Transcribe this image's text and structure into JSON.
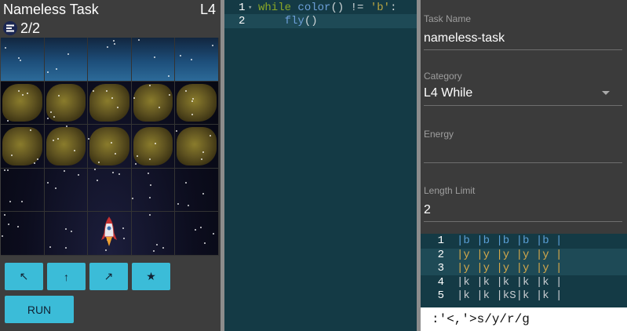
{
  "task": {
    "title": "Nameless Task",
    "level": "L4",
    "energy": "2/2",
    "energy_icon": "energy-icon"
  },
  "board": {
    "rows": [
      [
        "sky",
        "sky",
        "sky",
        "sky",
        "sky"
      ],
      [
        "asteroid",
        "asteroid",
        "asteroid",
        "asteroid",
        "asteroid"
      ],
      [
        "asteroid",
        "asteroid",
        "asteroid",
        "asteroid",
        "asteroid"
      ],
      [
        "space",
        "space",
        "space",
        "space",
        "space"
      ],
      [
        "space",
        "space",
        "rocket",
        "space",
        "space"
      ]
    ]
  },
  "controls": {
    "left": "↖",
    "forward": "↑",
    "right": "↗",
    "shoot": "★",
    "run": "RUN"
  },
  "editor": {
    "lines": [
      {
        "num": "1",
        "tokens": [
          [
            "kw",
            "while "
          ],
          [
            "fn",
            "color"
          ],
          [
            "op",
            "() != "
          ],
          [
            "str",
            "'b'"
          ],
          [
            "op",
            ":"
          ]
        ]
      },
      {
        "num": "2",
        "tokens": [
          [
            "op",
            "    "
          ],
          [
            "fn",
            "fly"
          ],
          [
            "op",
            "()"
          ]
        ]
      }
    ]
  },
  "form": {
    "task_name_label": "Task Name",
    "task_name_value": "nameless-task",
    "category_label": "Category",
    "category_value": "L4 While",
    "energy_label": "Energy",
    "energy_value": "",
    "length_label": "Length Limit",
    "length_value": "2"
  },
  "grid_source": {
    "lines": [
      {
        "num": "1",
        "text": "|b |b |b |b |b |",
        "color": "b"
      },
      {
        "num": "2",
        "text": "|y |y |y |y |y |",
        "color": "y"
      },
      {
        "num": "3",
        "text": "|y |y |y |y |y |",
        "color": "y"
      },
      {
        "num": "4",
        "text": "|k |k |k |k |k |",
        "color": "k"
      },
      {
        "num": "5",
        "text": "|k |k |kS|k |k |",
        "color": "k"
      }
    ]
  },
  "command": ":'<,'>s/y/r/g",
  "colors": {
    "accent": "#3bbcd8",
    "editor_bg": "#143a45",
    "panel_bg": "#3b3b3b"
  }
}
